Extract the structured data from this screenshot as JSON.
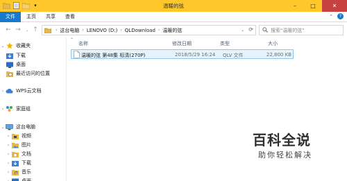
{
  "window": {
    "title": "温暖的弦",
    "controls": {
      "minimize": "–",
      "maximize": "□",
      "close": "✕"
    }
  },
  "ribbon": {
    "tabs": [
      "文件",
      "主页",
      "共享",
      "查看"
    ],
    "collapse_glyph": "⌃",
    "help_glyph": "?"
  },
  "address_bar": {
    "back_glyph": "←",
    "forward_glyph": "→",
    "up_glyph": "↑",
    "recent_glyph": "⌄",
    "path": [
      "这台电脑",
      "LENOVO (D:)",
      "QLDownload",
      "温暖的弦"
    ],
    "refresh_glyph": "⟳"
  },
  "search": {
    "placeholder": "搜索\"温暖的弦\""
  },
  "nav_pane": {
    "favorites": {
      "label": "收藏夹",
      "items": [
        "下载",
        "桌面",
        "最近访问的位置"
      ]
    },
    "wps": "WPS云文档",
    "homegroup": "家庭组",
    "this_pc": {
      "label": "这台电脑",
      "items": [
        "视频",
        "图片",
        "文档",
        "下载",
        "音乐",
        "桌面"
      ]
    }
  },
  "columns": {
    "name": "名称",
    "date": "修改日期",
    "type": "类型",
    "size": "大小"
  },
  "files": [
    {
      "name": "温暖的弦 第48集 标清(270P)",
      "date": "2018/5/29 16:24",
      "type": "QLV 文件",
      "size": "22,800 KB"
    }
  ],
  "colors": {
    "title_bar": "#ffc72a",
    "file_tab": "#1979ca",
    "selection": "#e5f3fb",
    "close_button": "#c74141"
  },
  "watermark": {
    "title": "百科全说",
    "subtitle": "助你轻松解决"
  }
}
